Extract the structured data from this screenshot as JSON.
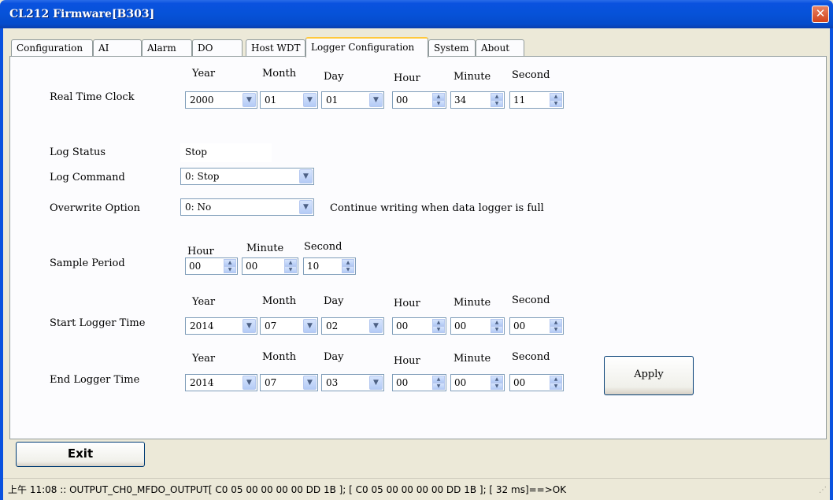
{
  "window": {
    "title": "CL212 Firmware[B303]",
    "close_glyph": "✕"
  },
  "tabs": [
    {
      "label": "Configuration"
    },
    {
      "label": "AI"
    },
    {
      "label": "Alarm"
    },
    {
      "label": "DO"
    },
    {
      "label": "Host WDT"
    },
    {
      "label": "Logger Configuration",
      "active": true
    },
    {
      "label": "System"
    },
    {
      "label": "About"
    }
  ],
  "headers": {
    "year": "Year",
    "month": "Month",
    "day": "Day",
    "hour": "Hour",
    "minute": "Minute",
    "second": "Second"
  },
  "rtc": {
    "label": "Real Time Clock",
    "year": "2000",
    "month": "01",
    "day": "01",
    "hour": "00",
    "minute": "34",
    "second": "11"
  },
  "log_status": {
    "label": "Log Status",
    "value": "Stop"
  },
  "log_command": {
    "label": "Log Command",
    "value": "0: Stop"
  },
  "overwrite": {
    "label": "Overwrite Option",
    "value": "0: No",
    "hint": "Continue writing when data logger is full"
  },
  "sample_period": {
    "label": "Sample Period",
    "hour": "00",
    "minute": "00",
    "second": "10"
  },
  "start_time": {
    "label": "Start Logger Time",
    "year": "2014",
    "month": "07",
    "day": "02",
    "hour": "00",
    "minute": "00",
    "second": "00"
  },
  "end_time": {
    "label": "End Logger Time",
    "year": "2014",
    "month": "07",
    "day": "03",
    "hour": "00",
    "minute": "00",
    "second": "00"
  },
  "buttons": {
    "apply": "Apply",
    "exit": "Exit"
  },
  "glyphs": {
    "dropdown": "▼",
    "up": "▲",
    "down": "▼",
    "grip": "⋰"
  },
  "status": {
    "text": "上午 11:08 :: OUTPUT_CH0_MFDO_OUTPUT[ C0 05 00 00 00 00 DD 1B ]; [ C0 05 00 00 00 00 DD 1B  ]; [ 32 ms]==>OK"
  }
}
